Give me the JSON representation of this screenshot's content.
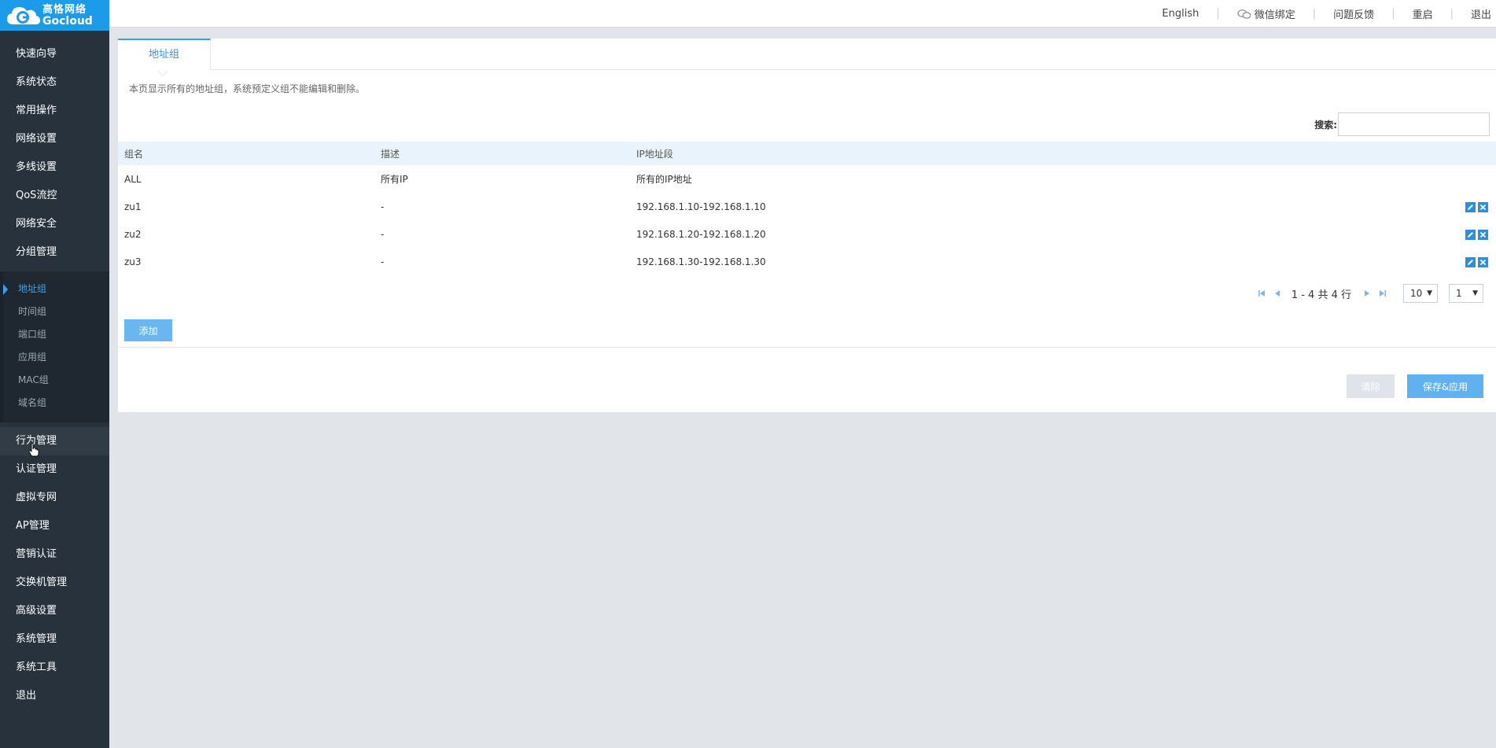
{
  "brand": {
    "name_cn": "高恪网络",
    "name_en": "Gocloud"
  },
  "topbar": {
    "links": [
      {
        "label": "English"
      },
      {
        "label": "微信绑定",
        "icon": "wechat-icon"
      },
      {
        "label": "问题反馈"
      },
      {
        "label": "重启"
      },
      {
        "label": "退出"
      }
    ]
  },
  "sidebar": {
    "items": [
      {
        "label": "快速向导"
      },
      {
        "label": "系统状态"
      },
      {
        "label": "常用操作"
      },
      {
        "label": "网络设置"
      },
      {
        "label": "多线设置"
      },
      {
        "label": "QoS流控"
      },
      {
        "label": "网络安全"
      },
      {
        "label": "分组管理"
      },
      {
        "label": "行为管理"
      },
      {
        "label": "认证管理"
      },
      {
        "label": "虚拟专网"
      },
      {
        "label": "AP管理"
      },
      {
        "label": "营销认证"
      },
      {
        "label": "交换机管理"
      },
      {
        "label": "高级设置"
      },
      {
        "label": "系统管理"
      },
      {
        "label": "系统工具"
      },
      {
        "label": "退出"
      }
    ],
    "submenu": [
      {
        "label": "地址组",
        "active": true
      },
      {
        "label": "时间组"
      },
      {
        "label": "端口组"
      },
      {
        "label": "应用组"
      },
      {
        "label": "MAC组"
      },
      {
        "label": "域名组"
      }
    ]
  },
  "main": {
    "tab": "地址组",
    "description": "本页显示所有的地址组，系统预定义组不能编辑和删除。",
    "search": {
      "label": "搜索:",
      "value": ""
    },
    "table": {
      "columns": [
        "组名",
        "描述",
        "IP地址段"
      ],
      "rows": [
        {
          "name": "ALL",
          "desc": "所有IP",
          "ip": "所有的IP地址",
          "editable": false
        },
        {
          "name": "zu1",
          "desc": "-",
          "ip": "192.168.1.10-192.168.1.10",
          "editable": true
        },
        {
          "name": "zu2",
          "desc": "-",
          "ip": "192.168.1.20-192.168.1.20",
          "editable": true
        },
        {
          "name": "zu3",
          "desc": "-",
          "ip": "192.168.1.30-192.168.1.30",
          "editable": true
        }
      ]
    },
    "pager": {
      "info": "1 - 4 共 4 行",
      "page_size": "10",
      "page": "1"
    },
    "add_label": "添加",
    "clear_label": "清除",
    "save_label": "保存&应用"
  },
  "colors": {
    "accent": "#3d9ff0",
    "sidebar_bg": "#28323c",
    "logo_bg": "#1c9bea"
  }
}
